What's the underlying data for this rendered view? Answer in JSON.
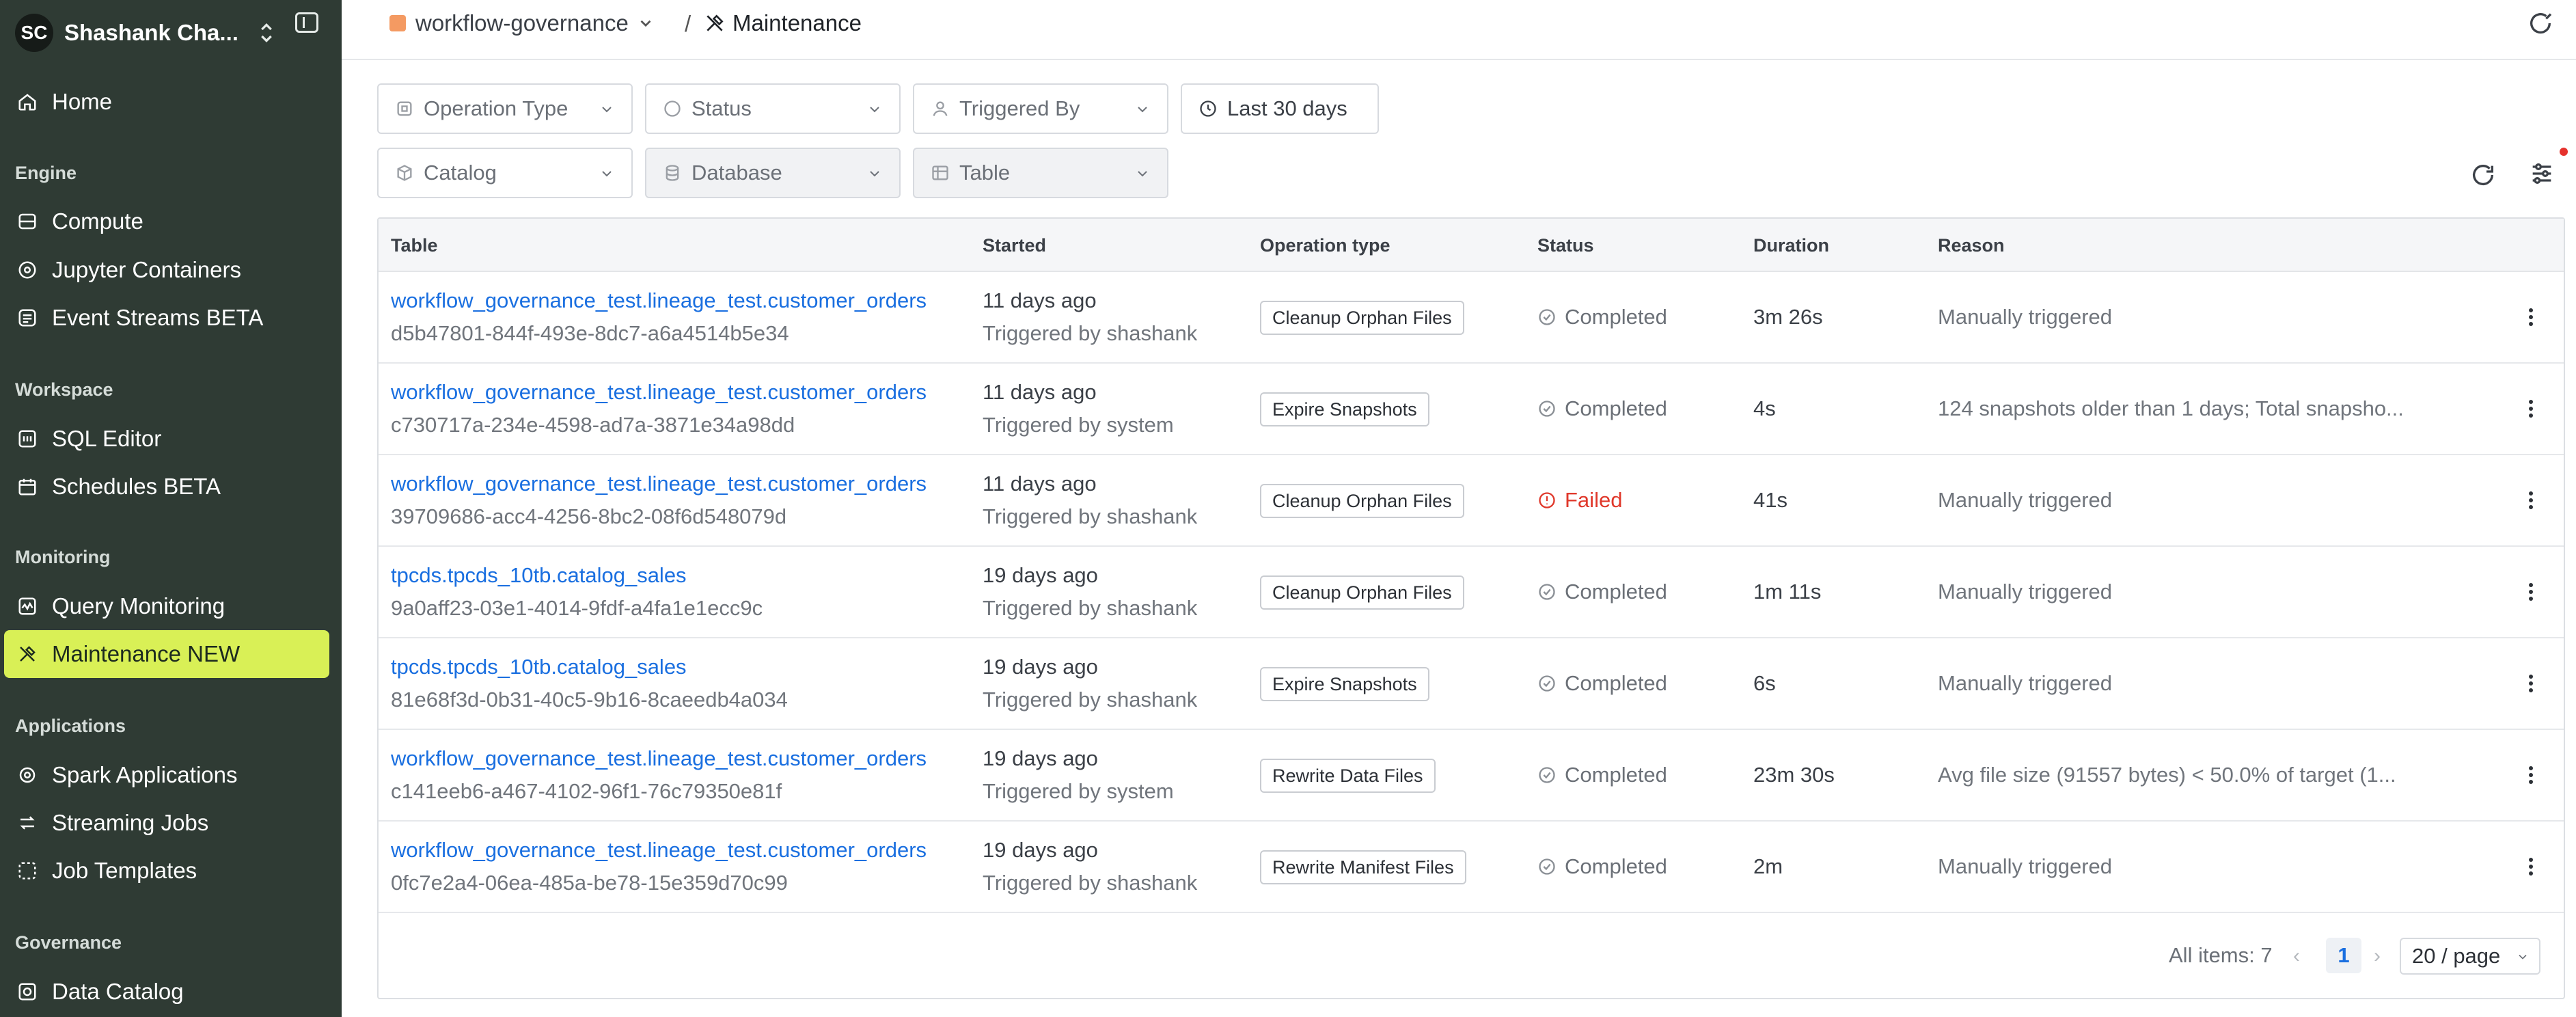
{
  "sidebar": {
    "user": {
      "initials": "SC",
      "name": "Shashank Cha..."
    },
    "home_label": "Home",
    "sections": {
      "engine": "Engine",
      "workspace": "Workspace",
      "monitoring": "Monitoring",
      "applications": "Applications",
      "governance": "Governance"
    },
    "items": {
      "compute": "Compute",
      "jupyter": "Jupyter Containers",
      "event_streams": "Event Streams BETA",
      "sql_editor": "SQL Editor",
      "schedules": "Schedules BETA",
      "query_monitoring": "Query Monitoring",
      "maintenance": "Maintenance NEW",
      "spark_apps": "Spark Applications",
      "streaming_jobs": "Streaming Jobs",
      "job_templates": "Job Templates",
      "data_catalog": "Data Catalog"
    },
    "active_color": "#d9f056",
    "bg_color": "#2f3b34"
  },
  "topbar": {
    "project": "workflow-governance",
    "separator": "/",
    "page": "Maintenance"
  },
  "filters": {
    "operation_type": "Operation Type",
    "status": "Status",
    "triggered_by": "Triggered By",
    "date_range": "Last 30 days",
    "catalog": "Catalog",
    "database": "Database",
    "table": "Table"
  },
  "table": {
    "headers": {
      "table": "Table",
      "started": "Started",
      "operation_type": "Operation type",
      "status": "Status",
      "duration": "Duration",
      "reason": "Reason"
    },
    "rows": [
      {
        "table": "workflow_governance_test.lineage_test.customer_orders",
        "id": "d5b47801-844f-493e-8dc7-a6a4514b5e34",
        "started": "11 days ago",
        "triggered": "Triggered by shashank",
        "operation": "Cleanup Orphan Files",
        "status": "Completed",
        "duration": "3m 26s",
        "reason": "Manually triggered"
      },
      {
        "table": "workflow_governance_test.lineage_test.customer_orders",
        "id": "c730717a-234e-4598-ad7a-3871e34a98dd",
        "started": "11 days ago",
        "triggered": "Triggered by system",
        "operation": "Expire Snapshots",
        "status": "Completed",
        "duration": "4s",
        "reason": "124 snapshots older than 1 days; Total snapsho..."
      },
      {
        "table": "workflow_governance_test.lineage_test.customer_orders",
        "id": "39709686-acc4-4256-8bc2-08f6d548079d",
        "started": "11 days ago",
        "triggered": "Triggered by shashank",
        "operation": "Cleanup Orphan Files",
        "status": "Failed",
        "duration": "41s",
        "reason": "Manually triggered"
      },
      {
        "table": "tpcds.tpcds_10tb.catalog_sales",
        "id": "9a0aff23-03e1-4014-9fdf-a4fa1e1ecc9c",
        "started": "19 days ago",
        "triggered": "Triggered by shashank",
        "operation": "Cleanup Orphan Files",
        "status": "Completed",
        "duration": "1m 11s",
        "reason": "Manually triggered"
      },
      {
        "table": "tpcds.tpcds_10tb.catalog_sales",
        "id": "81e68f3d-0b31-40c5-9b16-8caeedb4a034",
        "started": "19 days ago",
        "triggered": "Triggered by shashank",
        "operation": "Expire Snapshots",
        "status": "Completed",
        "duration": "6s",
        "reason": "Manually triggered"
      },
      {
        "table": "workflow_governance_test.lineage_test.customer_orders",
        "id": "c141eeb6-a467-4102-96f1-76c79350e81f",
        "started": "19 days ago",
        "triggered": "Triggered by system",
        "operation": "Rewrite Data Files",
        "status": "Completed",
        "duration": "23m 30s",
        "reason": "Avg file size (91557 bytes) < 50.0% of target (1..."
      },
      {
        "table": "workflow_governance_test.lineage_test.customer_orders",
        "id": "0fc7e2a4-06ea-485a-be78-15e359d70c99",
        "started": "19 days ago",
        "triggered": "Triggered by shashank",
        "operation": "Rewrite Manifest Files",
        "status": "Completed",
        "duration": "2m",
        "reason": "Manually triggered"
      }
    ]
  },
  "pagination": {
    "total": "All items: 7",
    "current_page": "1",
    "page_size": "20 / page"
  }
}
